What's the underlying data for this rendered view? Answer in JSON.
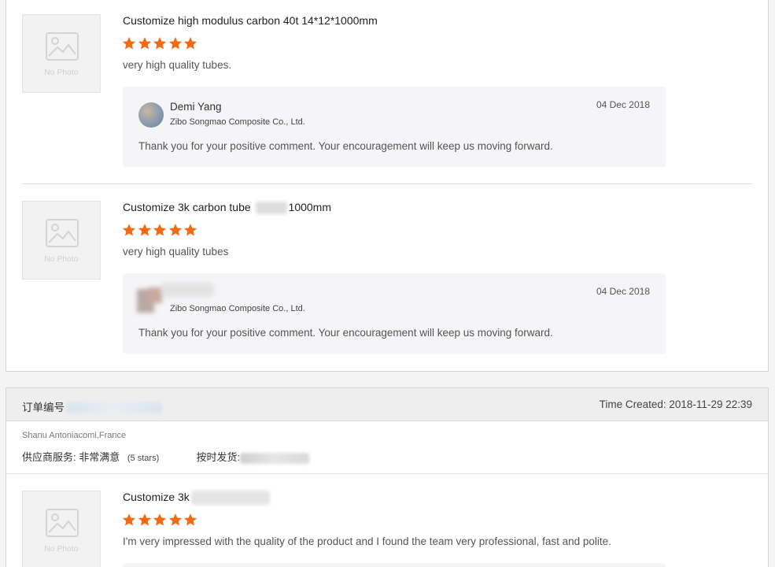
{
  "colors": {
    "star": "#f26a12",
    "placeholder": "#f2f2f2",
    "reply_bg": "#f5f5f7"
  },
  "icons": {
    "star": "star-icon",
    "no_photo": "image-placeholder-icon"
  },
  "reviews": [
    {
      "product_title": "Customize high modulus carbon 40t 14*12*1000mm",
      "no_photo_label": "No Photo",
      "rating": 5,
      "comment": "very high quality tubes.",
      "reply": {
        "name": "Demi Yang",
        "company": "Zibo Songmao Composite Co., Ltd.",
        "date": "04 Dec 2018",
        "text": "Thank you for your positive comment. Your encouragement will keep us moving forward."
      }
    },
    {
      "product_title_start": "Customize 3k carbon tube",
      "product_title_end": "1000mm",
      "no_photo_label": "No Photo",
      "rating": 5,
      "comment": "very high quality tubes",
      "reply": {
        "company": "Zibo Songmao Composite Co., Ltd.",
        "date": "04 Dec 2018",
        "text": "Thank you for your positive comment. Your encouragement will keep us moving forward."
      }
    }
  ],
  "order": {
    "label": "订单编号",
    "time_created": "Time Created: 2018-11-29 22:39",
    "buyer": "Shanu Antoniacomi,France",
    "supplier_service_label": "供应商服务:",
    "supplier_service_value": "非常满意",
    "supplier_service_stars": "(5 stars)",
    "on_time_label": "按时发货:",
    "review": {
      "product_title": "Customize 3k",
      "no_photo_label": "No Photo",
      "rating": 5,
      "comment": "I'm very impressed with the quality of the product and I found the team very professional, fast and polite."
    }
  }
}
